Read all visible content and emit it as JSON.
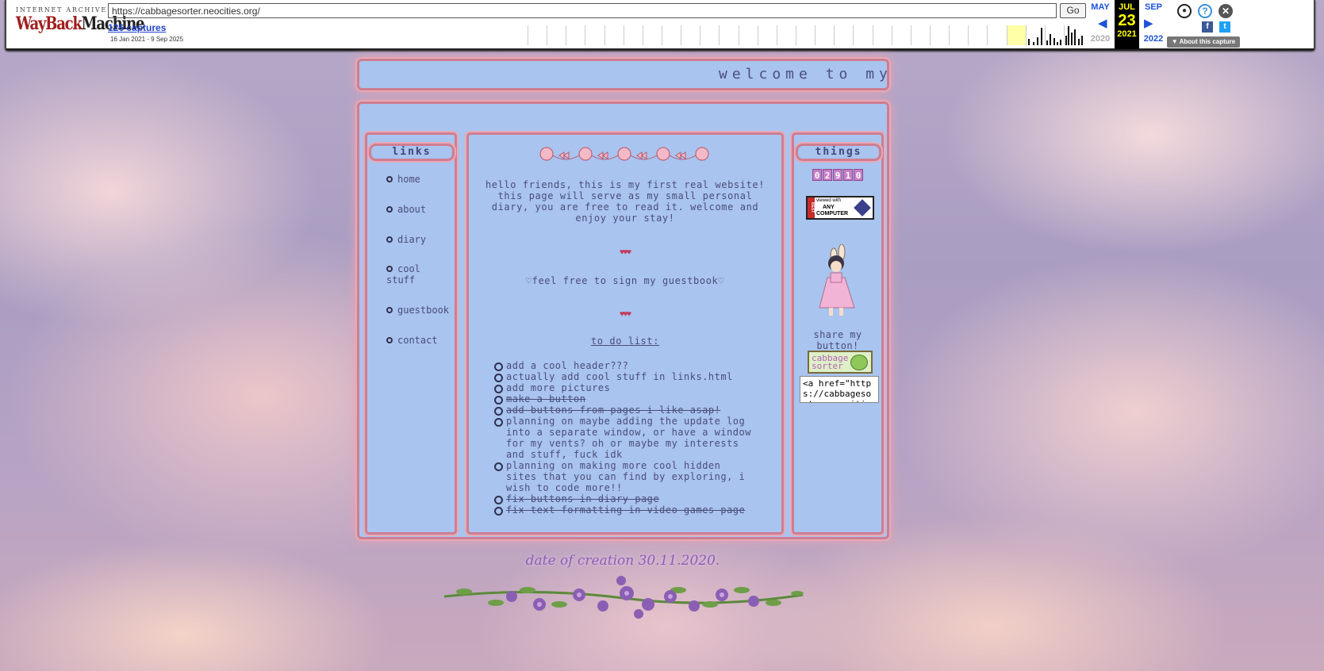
{
  "wayback": {
    "logo_top": "INTERNET ARCHIVE",
    "logo_wayback": "WayBack",
    "logo_machine": "Machine",
    "url": "https://cabbagesorter.neocities.org/",
    "go": "Go",
    "captures": "126 captures",
    "range": "16 Jan 2021 - 9 Sep 2025",
    "prev_month": "MAY",
    "cur_month": "JUL",
    "next_month": "SEP",
    "day": "23",
    "prev_year": "2020",
    "cur_year": "2021",
    "next_year": "2022",
    "about": "About this capture",
    "icons": [
      "user-icon",
      "help-icon",
      "close-icon",
      "facebook-icon",
      "twitter-icon"
    ]
  },
  "marquee": "welcome to my small corner of the internet",
  "links": {
    "title": "links",
    "items": [
      "home",
      "about",
      "diary",
      "cool\nstuff",
      "guestbook",
      "contact"
    ]
  },
  "center": {
    "intro": "hello friends, this is my first real website! this page will serve as my small personal diary, you are free to read it. welcome and enjoy your stay!",
    "hearts": "♥♥♥",
    "guestbook": "♡feel free to sign my guestbook♡",
    "todo_title": "to do list:",
    "todo": [
      {
        "text": "add a cool header???",
        "done": false
      },
      {
        "text": "actually add cool stuff in links.html",
        "done": false
      },
      {
        "text": "add more pictures",
        "done": false
      },
      {
        "text": "make a button",
        "done": true
      },
      {
        "text": "add buttons from pages i like asap!",
        "done": true
      },
      {
        "text": "planning on maybe adding the update log into a separate window, or have a window for my vents? oh or maybe my interests and stuff, fuck idk",
        "done": false
      },
      {
        "text": "planning on making more cool hidden sites that you can find by exploring, i wish to code more!!",
        "done": false
      },
      {
        "text": "fix buttons in diary page",
        "done": true
      },
      {
        "text": "fix text formatting in video games page",
        "done": true
      }
    ]
  },
  "things": {
    "title": "things",
    "counter": [
      "0",
      "2",
      "9",
      "1",
      "0"
    ],
    "badge_line1": "viewed with",
    "badge_line2": "ANY",
    "badge_line3": "COMPUTER",
    "badge_side": "BEST",
    "share": "share my button!",
    "button_line1": "cabbage",
    "button_line2": "sorter",
    "code": "<a href=\"https://cabbagesorter.neocities.org\">"
  },
  "footer": "date of creation 30.11.2020."
}
